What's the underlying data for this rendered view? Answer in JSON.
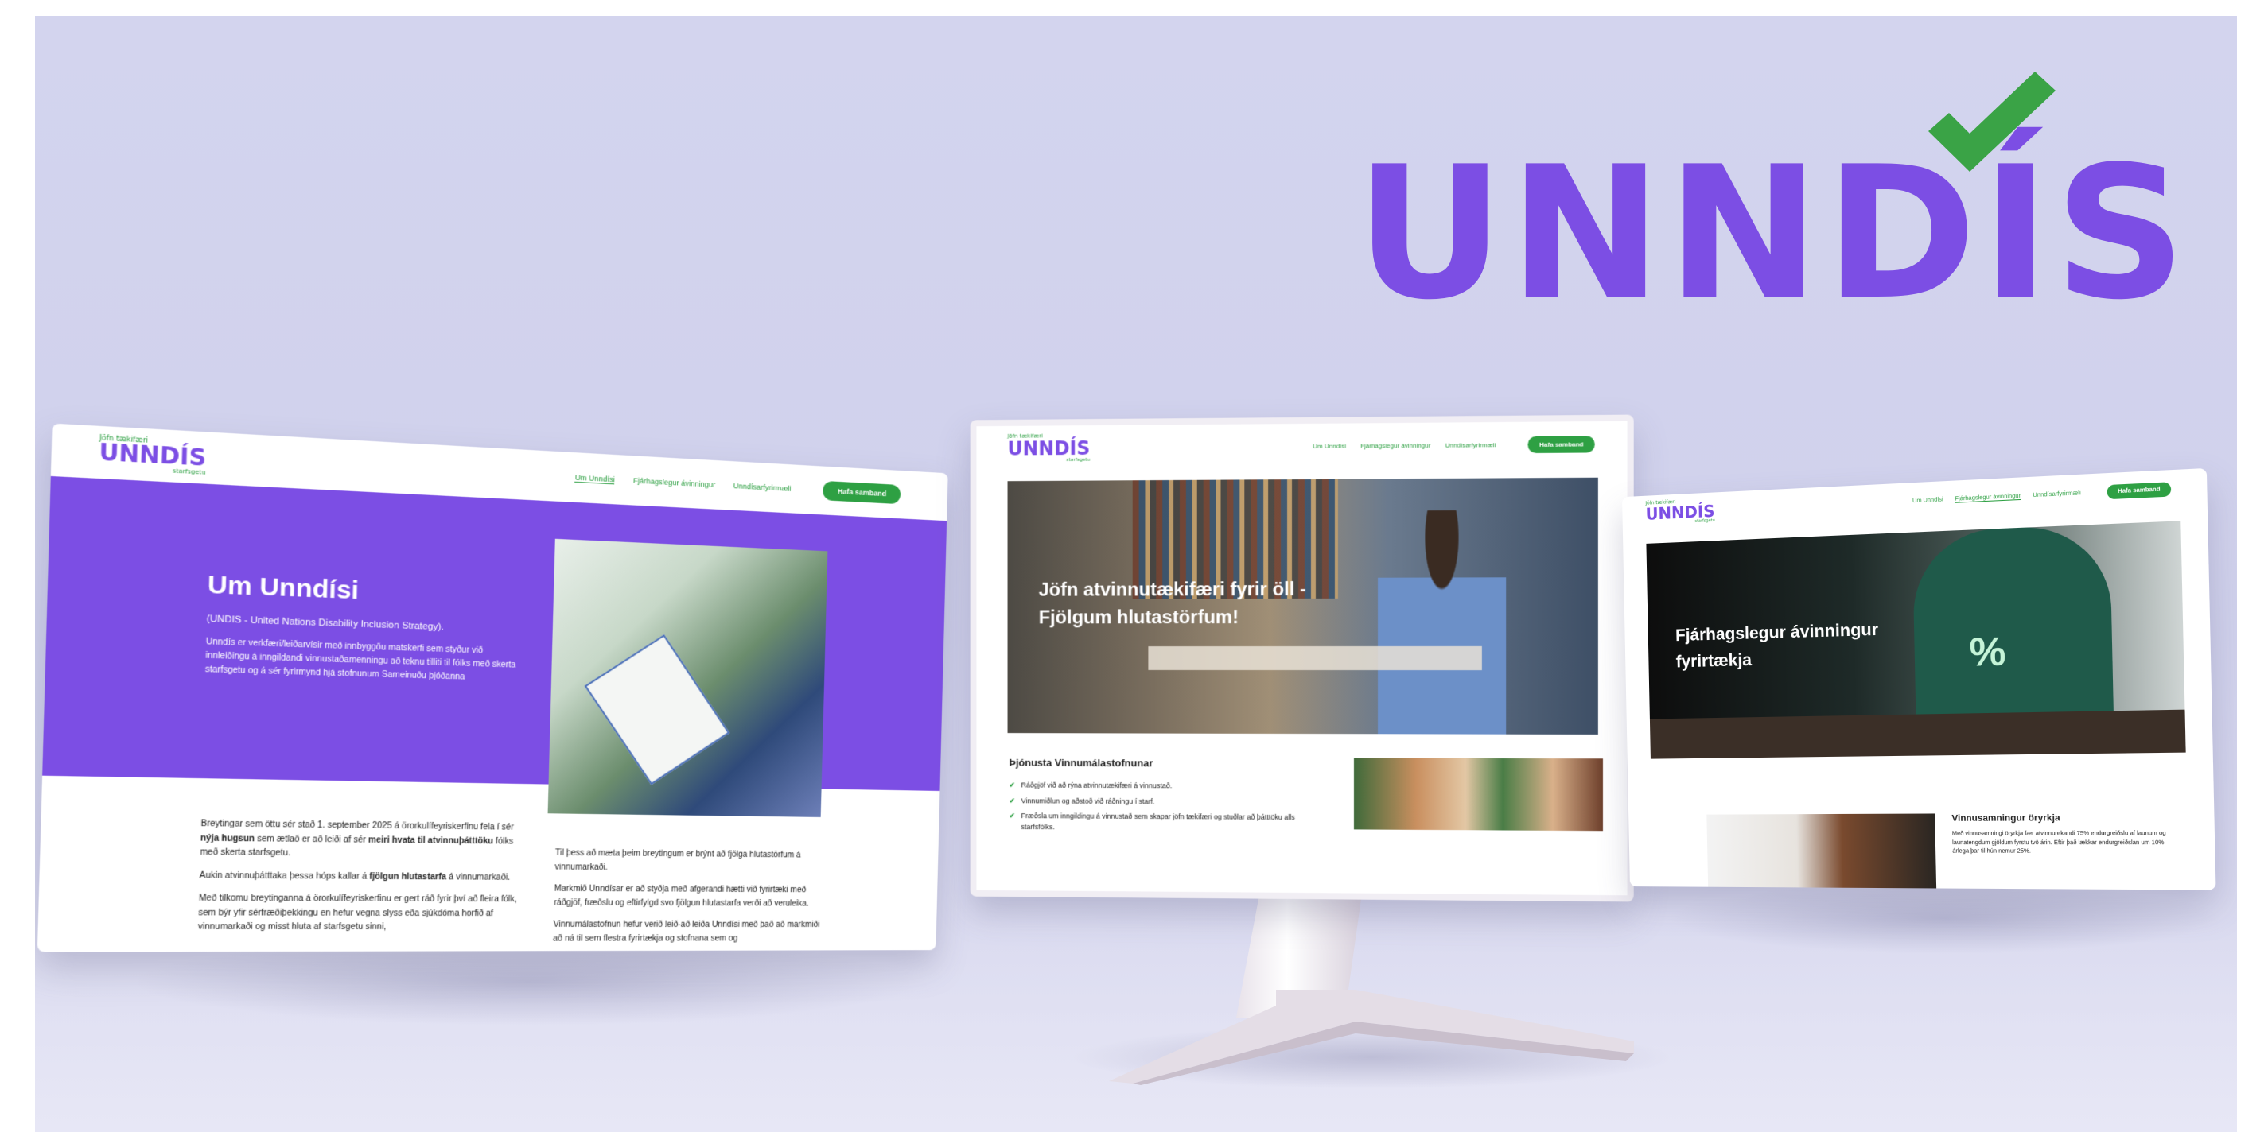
{
  "brand": {
    "wordmark": "UNNDÍS",
    "accent": "#7c4ee4",
    "check_color": "#3aa346"
  },
  "site": {
    "logo_tagline_top": "Jöfn tækifæri",
    "logo_text": "UNNDÍS",
    "logo_tagline_bottom": "starfsgetu"
  },
  "left_screen": {
    "nav": {
      "links": [
        "Um Unndísi",
        "Fjárhagslegur ávinningur",
        "Unndísarfyrirmæli"
      ],
      "cta": "Hafa samband"
    },
    "hero_title": "Um Unndísi",
    "hero_sub": "(UNDIS - United Nations Disability Inclusion Strategy).",
    "hero_body": "Unndís er verkfæri/leiðarvísir með innbyggðu matskerfi sem styður við innleiðingu á inngildandi vinnustaðamenningu  að teknu tilliti til fólks með skerta starfsgetu og á sér fyrirmynd hjá stofnunum Sameinuðu þjóðanna",
    "col1_p1_a": "Breytingar sem öttu sér stað 1. september 2025 á örorkulífeyriskerfinu fela í sér ",
    "col1_p1_b": "nýja hugsun",
    "col1_p1_c": " sem ætlað er að leiði af sér ",
    "col1_p1_d": "meiri hvata til atvinnuþátttöku",
    "col1_p1_e": " fólks með skerta starfsgetu.",
    "col1_p2_a": "Aukin atvinnuþátttaka þessa hóps kallar á ",
    "col1_p2_b": "fjölgun hlutastarfa",
    "col1_p2_c": " á vinnumarkaði.",
    "col1_p3": "Með tilkomu breytinganna á örorkulífeyriskerfinu er gert ráð fyrir því að fleira fólk, sem býr yfir sérfræðiþekkingu en hefur vegna slyss eða sjúkdóma horfið af vinnumarkaði og misst hluta af starfsgetu sinni,",
    "col2_p1": "Til þess að mæta þeim breytingum er brýnt að fjölga hlutastörfum á vinnumarkaði.",
    "col2_p2": "Markmið Unndísar er að styðja með afgerandi hætti við fyrirtæki með ráðgjöf, fræðslu og eftirfylgd svo fjölgun hlutastarfa verði að veruleika.",
    "col2_p3": "Vinnumálastofnun hefur verið leið-að leiða Unndísi með það að markmiði að ná til sem flestra fyrirtækja og stofnana sem og"
  },
  "center_screen": {
    "nav": {
      "links": [
        "Um Unndísi",
        "Fjárhagslegur ávinningur",
        "Unndísarfyrirmæli"
      ],
      "cta": "Hafa samband"
    },
    "hero_line1": "Jöfn atvinnutækifæri fyrir öll -",
    "hero_line2": "Fjölgum hlutastörfum!",
    "services_title": "Þjónusta Vinnumálastofnunar",
    "services": [
      "Ráðgjöf við að rýna atvinnutækifæri á vinnustað.",
      "Vinnumiðlun og aðstoð við ráðningu í starf.",
      "Fræðsla um inngildingu á vinnustað sem skapar jöfn tækifæri og stuðlar að þátttöku alls starfsfólks."
    ]
  },
  "right_screen": {
    "nav": {
      "links": [
        "Um Unndísi",
        "Fjárhagslegur ávinningur",
        "Unndísarfyrirmæli"
      ],
      "cta": "Hafa samband"
    },
    "hero_line1": "Fjárhagslegur ávinningur",
    "hero_line2": "fyrirtækja",
    "section_title": "Vinnusamningur öryrkja",
    "section_body": "Með vinnusamningi öryrkja fær atvinnurekandi 75% endurgreiðslu af launum og launatengdum gjöldum fyrstu tvö árin. Eftir það lækkar endurgreiðslan um 10% árlega þar til hún nemur 25%."
  }
}
